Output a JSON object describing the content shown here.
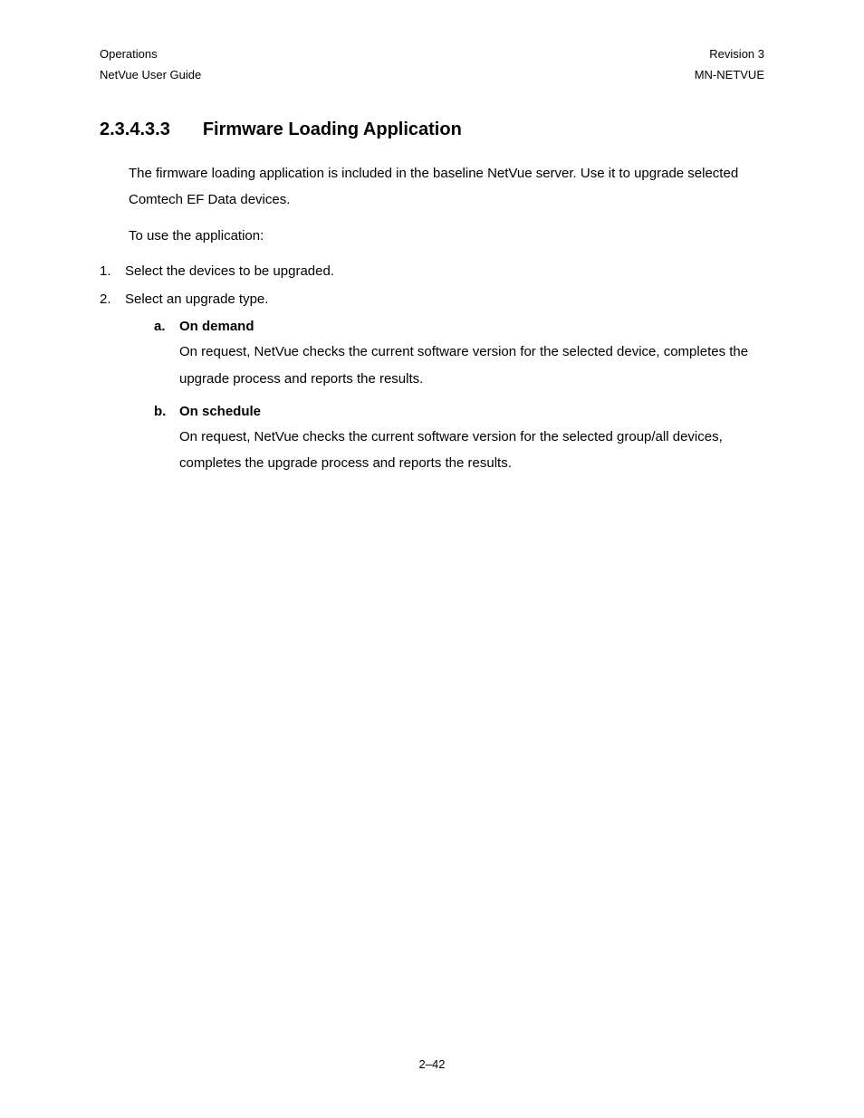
{
  "header": {
    "left_line_1": "Operations",
    "left_line_2": "NetVue User Guide",
    "right_line_1": "Revision 3",
    "right_line_2": "MN-NETVUE"
  },
  "section": {
    "number": "2.3.4.3.3",
    "title": "Firmware Loading Application"
  },
  "intro": "The firmware loading application is included in the baseline NetVue server. Use it to upgrade selected Comtech EF Data devices.",
  "instruction": "To use the application:",
  "steps": [
    {
      "marker": "1.",
      "text": "Select the devices to be upgraded."
    },
    {
      "marker": "2.",
      "text": "Select an upgrade type."
    }
  ],
  "subitems": [
    {
      "marker": "a.",
      "title": "On demand",
      "body": "On request, NetVue checks the current software version for the selected device, completes the upgrade process and reports the results."
    },
    {
      "marker": "b.",
      "title": "On schedule",
      "body": "On request, NetVue checks the current software version for the selected group/all devices, completes the upgrade process and reports the results."
    }
  ],
  "footer": "2–42"
}
